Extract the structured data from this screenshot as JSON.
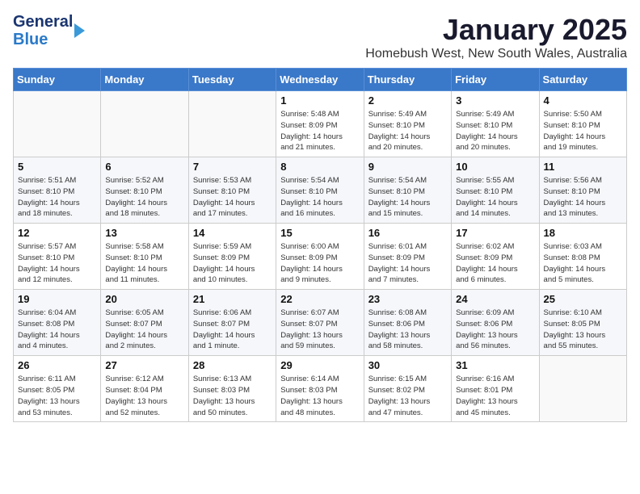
{
  "logo": {
    "general": "General",
    "blue": "Blue"
  },
  "header": {
    "month": "January 2025",
    "location": "Homebush West, New South Wales, Australia"
  },
  "days_of_week": [
    "Sunday",
    "Monday",
    "Tuesday",
    "Wednesday",
    "Thursday",
    "Friday",
    "Saturday"
  ],
  "weeks": [
    {
      "cells": [
        {
          "day": "",
          "info": ""
        },
        {
          "day": "",
          "info": ""
        },
        {
          "day": "",
          "info": ""
        },
        {
          "day": "1",
          "info": "Sunrise: 5:48 AM\nSunset: 8:09 PM\nDaylight: 14 hours\nand 21 minutes."
        },
        {
          "day": "2",
          "info": "Sunrise: 5:49 AM\nSunset: 8:10 PM\nDaylight: 14 hours\nand 20 minutes."
        },
        {
          "day": "3",
          "info": "Sunrise: 5:49 AM\nSunset: 8:10 PM\nDaylight: 14 hours\nand 20 minutes."
        },
        {
          "day": "4",
          "info": "Sunrise: 5:50 AM\nSunset: 8:10 PM\nDaylight: 14 hours\nand 19 minutes."
        }
      ]
    },
    {
      "cells": [
        {
          "day": "5",
          "info": "Sunrise: 5:51 AM\nSunset: 8:10 PM\nDaylight: 14 hours\nand 18 minutes."
        },
        {
          "day": "6",
          "info": "Sunrise: 5:52 AM\nSunset: 8:10 PM\nDaylight: 14 hours\nand 18 minutes."
        },
        {
          "day": "7",
          "info": "Sunrise: 5:53 AM\nSunset: 8:10 PM\nDaylight: 14 hours\nand 17 minutes."
        },
        {
          "day": "8",
          "info": "Sunrise: 5:54 AM\nSunset: 8:10 PM\nDaylight: 14 hours\nand 16 minutes."
        },
        {
          "day": "9",
          "info": "Sunrise: 5:54 AM\nSunset: 8:10 PM\nDaylight: 14 hours\nand 15 minutes."
        },
        {
          "day": "10",
          "info": "Sunrise: 5:55 AM\nSunset: 8:10 PM\nDaylight: 14 hours\nand 14 minutes."
        },
        {
          "day": "11",
          "info": "Sunrise: 5:56 AM\nSunset: 8:10 PM\nDaylight: 14 hours\nand 13 minutes."
        }
      ]
    },
    {
      "cells": [
        {
          "day": "12",
          "info": "Sunrise: 5:57 AM\nSunset: 8:10 PM\nDaylight: 14 hours\nand 12 minutes."
        },
        {
          "day": "13",
          "info": "Sunrise: 5:58 AM\nSunset: 8:10 PM\nDaylight: 14 hours\nand 11 minutes."
        },
        {
          "day": "14",
          "info": "Sunrise: 5:59 AM\nSunset: 8:09 PM\nDaylight: 14 hours\nand 10 minutes."
        },
        {
          "day": "15",
          "info": "Sunrise: 6:00 AM\nSunset: 8:09 PM\nDaylight: 14 hours\nand 9 minutes."
        },
        {
          "day": "16",
          "info": "Sunrise: 6:01 AM\nSunset: 8:09 PM\nDaylight: 14 hours\nand 7 minutes."
        },
        {
          "day": "17",
          "info": "Sunrise: 6:02 AM\nSunset: 8:09 PM\nDaylight: 14 hours\nand 6 minutes."
        },
        {
          "day": "18",
          "info": "Sunrise: 6:03 AM\nSunset: 8:08 PM\nDaylight: 14 hours\nand 5 minutes."
        }
      ]
    },
    {
      "cells": [
        {
          "day": "19",
          "info": "Sunrise: 6:04 AM\nSunset: 8:08 PM\nDaylight: 14 hours\nand 4 minutes."
        },
        {
          "day": "20",
          "info": "Sunrise: 6:05 AM\nSunset: 8:07 PM\nDaylight: 14 hours\nand 2 minutes."
        },
        {
          "day": "21",
          "info": "Sunrise: 6:06 AM\nSunset: 8:07 PM\nDaylight: 14 hours\nand 1 minute."
        },
        {
          "day": "22",
          "info": "Sunrise: 6:07 AM\nSunset: 8:07 PM\nDaylight: 13 hours\nand 59 minutes."
        },
        {
          "day": "23",
          "info": "Sunrise: 6:08 AM\nSunset: 8:06 PM\nDaylight: 13 hours\nand 58 minutes."
        },
        {
          "day": "24",
          "info": "Sunrise: 6:09 AM\nSunset: 8:06 PM\nDaylight: 13 hours\nand 56 minutes."
        },
        {
          "day": "25",
          "info": "Sunrise: 6:10 AM\nSunset: 8:05 PM\nDaylight: 13 hours\nand 55 minutes."
        }
      ]
    },
    {
      "cells": [
        {
          "day": "26",
          "info": "Sunrise: 6:11 AM\nSunset: 8:05 PM\nDaylight: 13 hours\nand 53 minutes."
        },
        {
          "day": "27",
          "info": "Sunrise: 6:12 AM\nSunset: 8:04 PM\nDaylight: 13 hours\nand 52 minutes."
        },
        {
          "day": "28",
          "info": "Sunrise: 6:13 AM\nSunset: 8:03 PM\nDaylight: 13 hours\nand 50 minutes."
        },
        {
          "day": "29",
          "info": "Sunrise: 6:14 AM\nSunset: 8:03 PM\nDaylight: 13 hours\nand 48 minutes."
        },
        {
          "day": "30",
          "info": "Sunrise: 6:15 AM\nSunset: 8:02 PM\nDaylight: 13 hours\nand 47 minutes."
        },
        {
          "day": "31",
          "info": "Sunrise: 6:16 AM\nSunset: 8:01 PM\nDaylight: 13 hours\nand 45 minutes."
        },
        {
          "day": "",
          "info": ""
        }
      ]
    }
  ]
}
